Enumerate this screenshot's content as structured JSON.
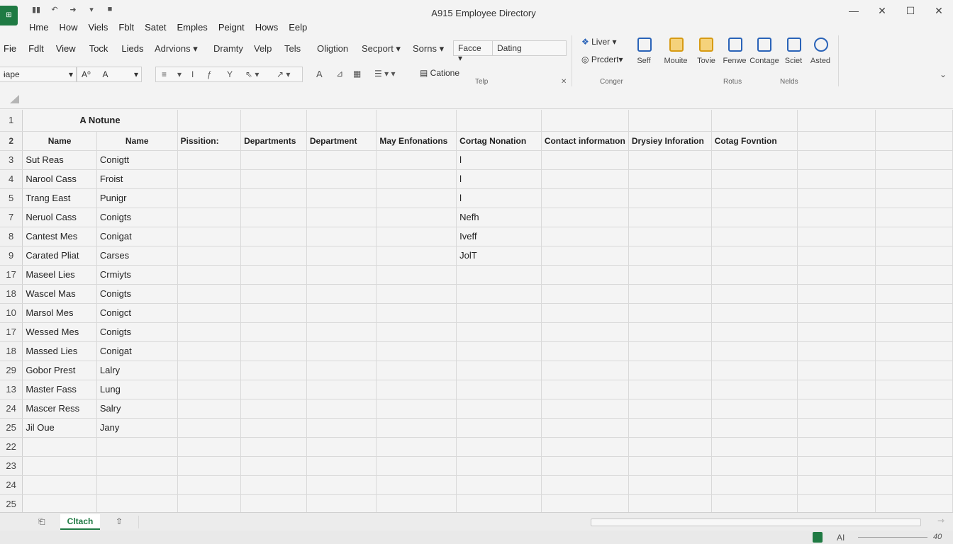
{
  "app": {
    "logo_text": "⊞",
    "window_title": "A915 Employee Directory",
    "qat_icons": [
      "save-icon",
      "undo-icon",
      "redo-icon",
      "customize-icon",
      "lock-icon"
    ]
  },
  "window_controls": [
    "—",
    "✕",
    "☐",
    "✕"
  ],
  "tabs": [
    "Hme",
    "How",
    "Viels",
    "Fblt",
    "Satet",
    "Emples",
    "Peignt",
    "Hows",
    "Eelp"
  ],
  "submenu": {
    "items": [
      "Fie",
      "Fdlt",
      "View",
      "Tock",
      "Lieds"
    ],
    "advisors": "Adrvions",
    "draw": "Dramty",
    "help": "Velp",
    "tels": "Tels",
    "option": "Oligtion",
    "support": "Secport",
    "sons": "Sorns",
    "face_label": "Facce",
    "face_value": "Dating"
  },
  "ribbon": {
    "font_box": "ɨape",
    "font_size_sym": "A⁰",
    "font_a": "A",
    "caption": "Catione",
    "caption_group": "Telp",
    "liver": "Liver",
    "product": "Prcdert",
    "buttons": [
      {
        "label": "Seff",
        "icon": "format-icon"
      },
      {
        "label": "Mouite",
        "icon": "paste-icon"
      },
      {
        "label": "Tovie",
        "icon": "chart-icon"
      },
      {
        "label": "Fenwe",
        "icon": "document-icon"
      },
      {
        "label": "Contage",
        "icon": "image-icon"
      },
      {
        "label": "Sciet",
        "icon": "file-icon"
      },
      {
        "label": "Asted",
        "icon": "info-icon"
      }
    ],
    "group_conger": "Conger",
    "group_rotus": "Rotus",
    "group_nelds": "Nelds"
  },
  "sheet": {
    "title_cell": "A Notune",
    "headers": [
      "Name",
      "Name",
      "Pissition:",
      "Departments",
      "Department",
      "May Enfonations",
      "Cortag Nonation",
      "Contact informatıon",
      "Drysiey Inforation",
      "Cotag Fovntion",
      "",
      ""
    ],
    "rows": [
      {
        "n": "3",
        "c": [
          "Sut Reas",
          "Conigtt",
          "",
          "",
          "",
          "",
          "l",
          "",
          "",
          "",
          "",
          ""
        ]
      },
      {
        "n": "4",
        "c": [
          "Narool Cass",
          "Froist",
          "",
          "",
          "",
          "",
          "l",
          "",
          "",
          "",
          "",
          ""
        ]
      },
      {
        "n": "5",
        "c": [
          "Trang East",
          "Punigr",
          "",
          "",
          "",
          "",
          "l",
          "",
          "",
          "",
          "",
          ""
        ]
      },
      {
        "n": "7",
        "c": [
          "Neruol Cass",
          "Conigts",
          "",
          "",
          "",
          "",
          "Nefh",
          "",
          "",
          "",
          "",
          ""
        ]
      },
      {
        "n": "8",
        "c": [
          "Cantest Mes",
          "Conigat",
          "",
          "",
          "",
          "",
          "Iveff",
          "",
          "",
          "",
          "",
          ""
        ]
      },
      {
        "n": "9",
        "c": [
          "Carated Pliat",
          "Carses",
          "",
          "",
          "",
          "",
          "JolT",
          "",
          "",
          "",
          "",
          ""
        ]
      },
      {
        "n": "17",
        "c": [
          "Maseel Lies",
          "Crmiyts",
          "",
          "",
          "",
          "",
          "",
          "",
          "",
          "",
          "",
          ""
        ]
      },
      {
        "n": "18",
        "c": [
          "Wascel Mas",
          "Conigts",
          "",
          "",
          "",
          "",
          "",
          "",
          "",
          "",
          "",
          ""
        ]
      },
      {
        "n": "10",
        "c": [
          "Marsol Mes",
          "Conigct",
          "",
          "",
          "",
          "",
          "",
          "",
          "",
          "",
          "",
          ""
        ]
      },
      {
        "n": "17",
        "c": [
          "Wessed Mes",
          "Conigts",
          "",
          "",
          "",
          "",
          "",
          "",
          "",
          "",
          "",
          ""
        ]
      },
      {
        "n": "18",
        "c": [
          "Massed Lies",
          "Conigat",
          "",
          "",
          "",
          "",
          "",
          "",
          "",
          "",
          "",
          ""
        ]
      },
      {
        "n": "29",
        "c": [
          "Gobor Prest",
          "Lalry",
          "",
          "",
          "",
          "",
          "",
          "",
          "",
          "",
          "",
          ""
        ]
      },
      {
        "n": "13",
        "c": [
          "Master Fass",
          "Lung",
          "",
          "",
          "",
          "",
          "",
          "",
          "",
          "",
          "",
          ""
        ]
      },
      {
        "n": "24",
        "c": [
          "Mascer Ress",
          "Salry",
          "",
          "",
          "",
          "",
          "",
          "",
          "",
          "",
          "",
          ""
        ]
      },
      {
        "n": "25",
        "c": [
          "Jil Oue",
          "Jany",
          "",
          "",
          "",
          "",
          "",
          "",
          "",
          "",
          "",
          ""
        ]
      },
      {
        "n": "22",
        "c": [
          "",
          "",
          "",
          "",
          "",
          "",
          "",
          "",
          "",
          "",
          "",
          ""
        ]
      },
      {
        "n": "23",
        "c": [
          "",
          "",
          "",
          "",
          "",
          "",
          "",
          "",
          "",
          "",
          "",
          ""
        ]
      },
      {
        "n": "24",
        "c": [
          "",
          "",
          "",
          "",
          "",
          "",
          "",
          "",
          "",
          "",
          "",
          ""
        ]
      },
      {
        "n": "25",
        "c": [
          "",
          "",
          "",
          "",
          "",
          "",
          "",
          "",
          "",
          "",
          "",
          ""
        ]
      }
    ]
  },
  "sheet_tabs": {
    "active": "Cltach"
  },
  "status": {
    "ai": "AI",
    "zoom": "40"
  },
  "colors": {
    "accent": "#1f7a43",
    "grid": "#d9d9d9",
    "icon_blue": "#2a63b8"
  }
}
